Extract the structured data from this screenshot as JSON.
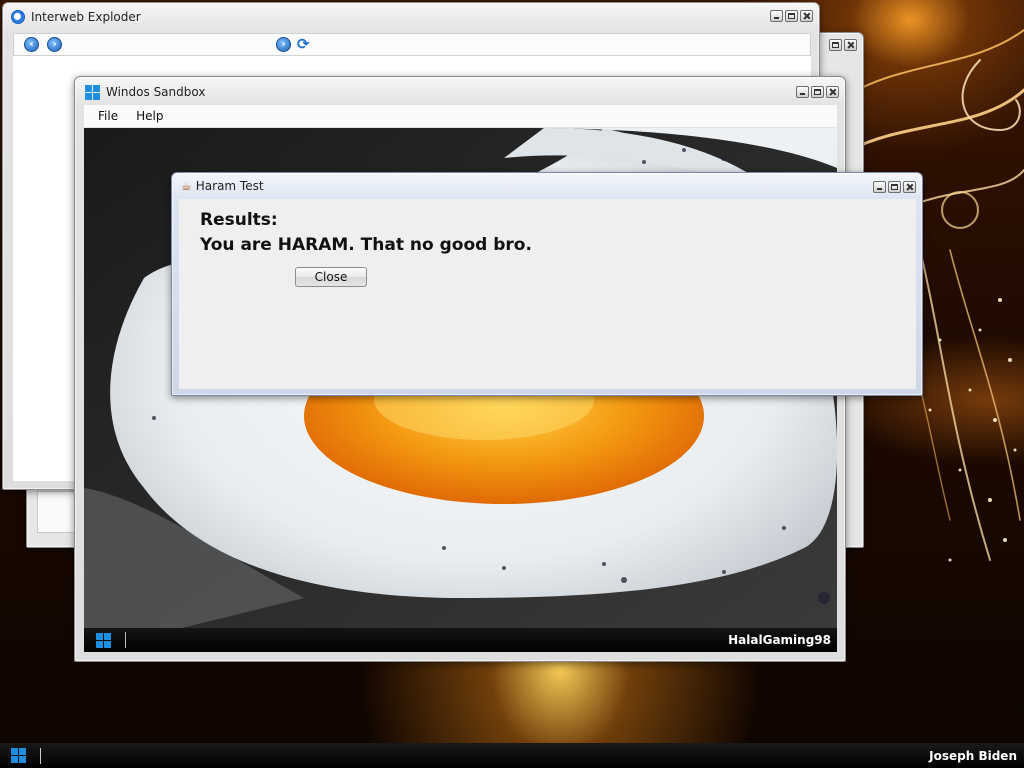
{
  "desktop": {
    "user_name": "Joseph Biden"
  },
  "browser": {
    "title": "Interweb Exploder"
  },
  "sandbox": {
    "title": "Windos Sandbox",
    "menu": [
      "File",
      "Help"
    ],
    "taskbar_user": "HalalGaming98"
  },
  "dialog": {
    "title": "Haram Test",
    "heading": "Results:",
    "message": "You are HARAM. That no good bro.",
    "close_label": "Close"
  }
}
